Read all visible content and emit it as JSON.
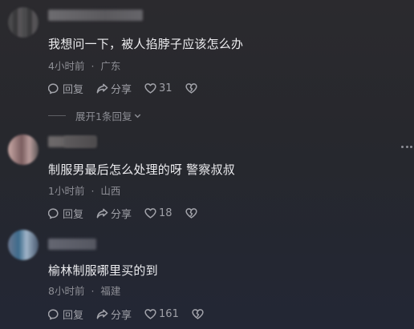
{
  "comments": [
    {
      "text": "我想问一下，被人掐脖子应该怎么办",
      "time": "4小时前",
      "location": "广东",
      "reply_label": "回复",
      "share_label": "分享",
      "likes": "31",
      "replies_toggle": "展开1条回复"
    },
    {
      "text": "制服男最后怎么处理的呀 警察叔叔",
      "time": "1小时前",
      "location": "山西",
      "reply_label": "回复",
      "share_label": "分享",
      "likes": "18"
    },
    {
      "text": "榆林制服哪里买的到",
      "time": "8小时前",
      "location": "福建",
      "reply_label": "回复",
      "share_label": "分享",
      "likes": "161"
    }
  ],
  "separator": "·",
  "icons": [
    "comment-bubble-icon",
    "share-arrow-icon",
    "heart-icon",
    "broken-heart-icon",
    "chevron-down-icon",
    "more-icon"
  ]
}
